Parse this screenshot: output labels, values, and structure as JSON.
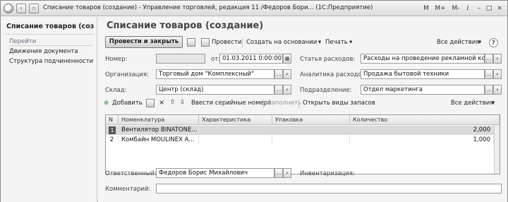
{
  "window": {
    "title": "Списание товаров (создание) - Управление торговлей, редакция 11 /Федоров Бори...    (1С:Предприятие)",
    "right_controls": [
      "M",
      "M+",
      "M-",
      "i"
    ]
  },
  "left_panel": {
    "title": "Списание товаров (соз...",
    "section": "Перейти",
    "items": [
      "Движения документа",
      "Структура подчиненности"
    ]
  },
  "form": {
    "title": "Списание товаров (создание)",
    "toolbar": {
      "post_close": "Провести и закрыть",
      "post": "Провести",
      "create_based": "Создать на основании",
      "print": "Печать",
      "all_actions": "Все действия"
    },
    "fields": {
      "number_label": "Номер:",
      "number_value": "",
      "from_label": "от:",
      "date_value": "01.03.2011  0:00:00",
      "org_label": "Организация:",
      "org_value": "Торговый дом \"Комплексный\"",
      "warehouse_label": "Склад:",
      "warehouse_value": "Центр (склад)",
      "expense_label": "Статья расходов:",
      "expense_value": "Расходы на проведение рекламной ком",
      "analytics_label": "Аналитика расходов:",
      "analytics_value": "Продажа бытовой техники",
      "division_label": "Подразделение:",
      "division_value": "Отдел маркетинга",
      "responsible_label": "Ответственный:",
      "responsible_value": "Федоров Борис Михайлович",
      "inventory_label": "Инвентаризация:",
      "comment_label": "Комментарий:",
      "comment_value": ""
    },
    "table_toolbar": {
      "add": "Добавить",
      "serials": "Ввести серийные номера",
      "fill": "Заполнить",
      "open_stock": "Открыть виды запасов",
      "all_actions": "Все действия"
    },
    "table": {
      "columns": [
        "N",
        "Номенклатура",
        "Характеристика",
        "Упаковка",
        "Количество"
      ],
      "rows": [
        {
          "n": "1",
          "item": "Вентилятор BINATONE...",
          "char": "",
          "pack": "",
          "qty": "2,000"
        },
        {
          "n": "2",
          "item": "Комбайн MOULINEX  A...",
          "char": "",
          "pack": "",
          "qty": "1,000"
        }
      ]
    }
  }
}
